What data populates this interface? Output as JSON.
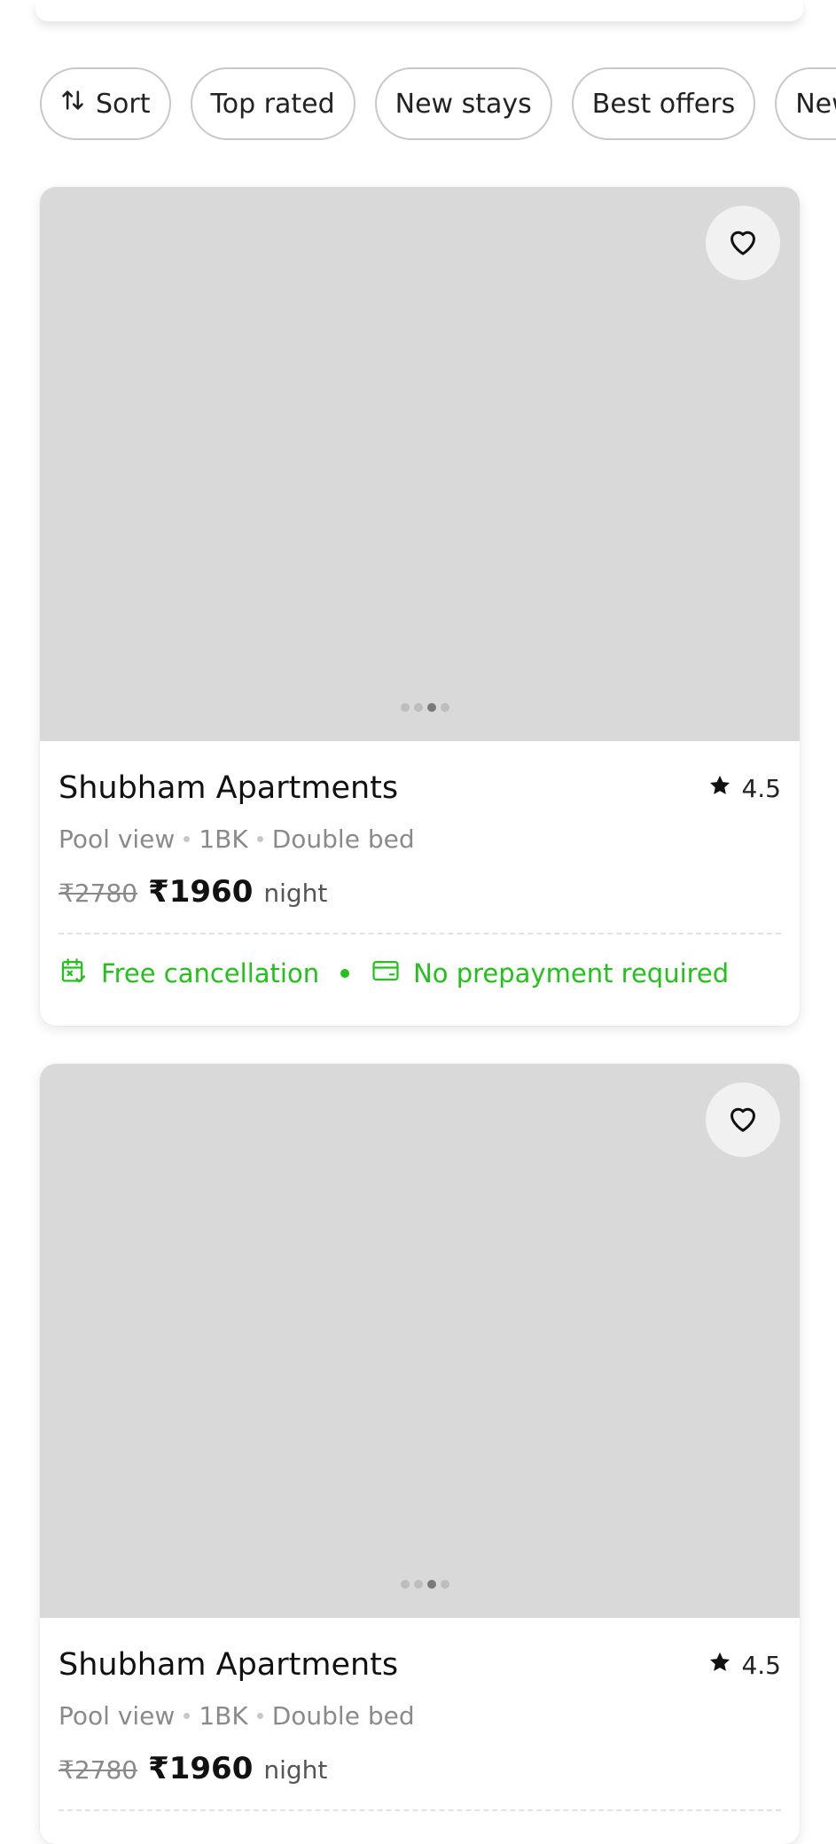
{
  "filters": [
    {
      "label": "Sort",
      "icon": "sort-arrows-icon"
    },
    {
      "label": "Top rated"
    },
    {
      "label": "New stays"
    },
    {
      "label": "Best offers"
    },
    {
      "label": "New"
    }
  ],
  "listings": [
    {
      "name": "Shubham Apartments",
      "rating": "4.5",
      "features": [
        "Pool view",
        "1BK",
        "Double bed"
      ],
      "old_price": "₹2780",
      "price": "₹1960",
      "price_unit": "night",
      "perk_1": "Free cancellation",
      "perk_2": "No prepayment required",
      "photo_count": 4,
      "active_photo": 3
    },
    {
      "name": "Shubham Apartments",
      "rating": "4.5",
      "features": [
        "Pool view",
        "1BK",
        "Double bed"
      ],
      "old_price": "₹2780",
      "price": "₹1960",
      "price_unit": "night",
      "photo_count": 4,
      "active_photo": 3
    }
  ],
  "colors": {
    "accent_green": "#22c21a",
    "photo_placeholder": "#d9d9d9",
    "muted_text": "#8a8a8a"
  }
}
